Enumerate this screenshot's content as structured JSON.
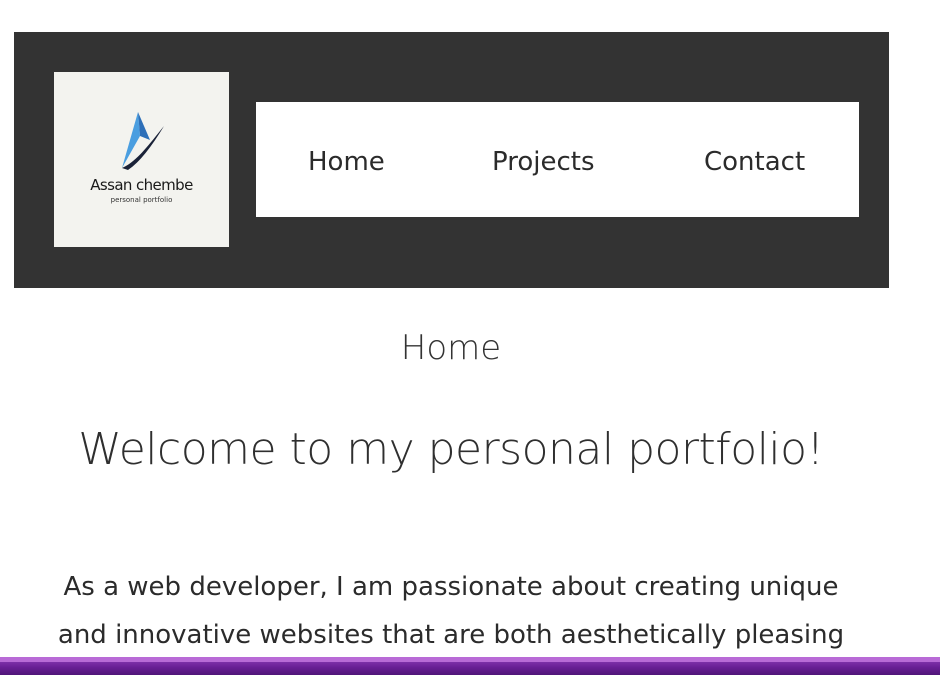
{
  "logo": {
    "name": "Assan chembe",
    "tagline": "personal portfolio",
    "colors": {
      "background": "#f3f3ef",
      "accent_blue": "#4a9ee0",
      "dark": "#1a2238"
    }
  },
  "nav": {
    "items": [
      {
        "label": "Home"
      },
      {
        "label": "Projects"
      },
      {
        "label": "Contact"
      }
    ]
  },
  "main": {
    "page_heading": "Home",
    "welcome": "Welcome to my personal portfolio!",
    "intro_lines": [
      "As a web developer, I am passionate about creating unique",
      "and innovative websites that are both aesthetically pleasing"
    ]
  },
  "colors": {
    "header_bg": "#333333",
    "nav_bg": "#ffffff",
    "bottom_bar": "#6a1f96"
  }
}
